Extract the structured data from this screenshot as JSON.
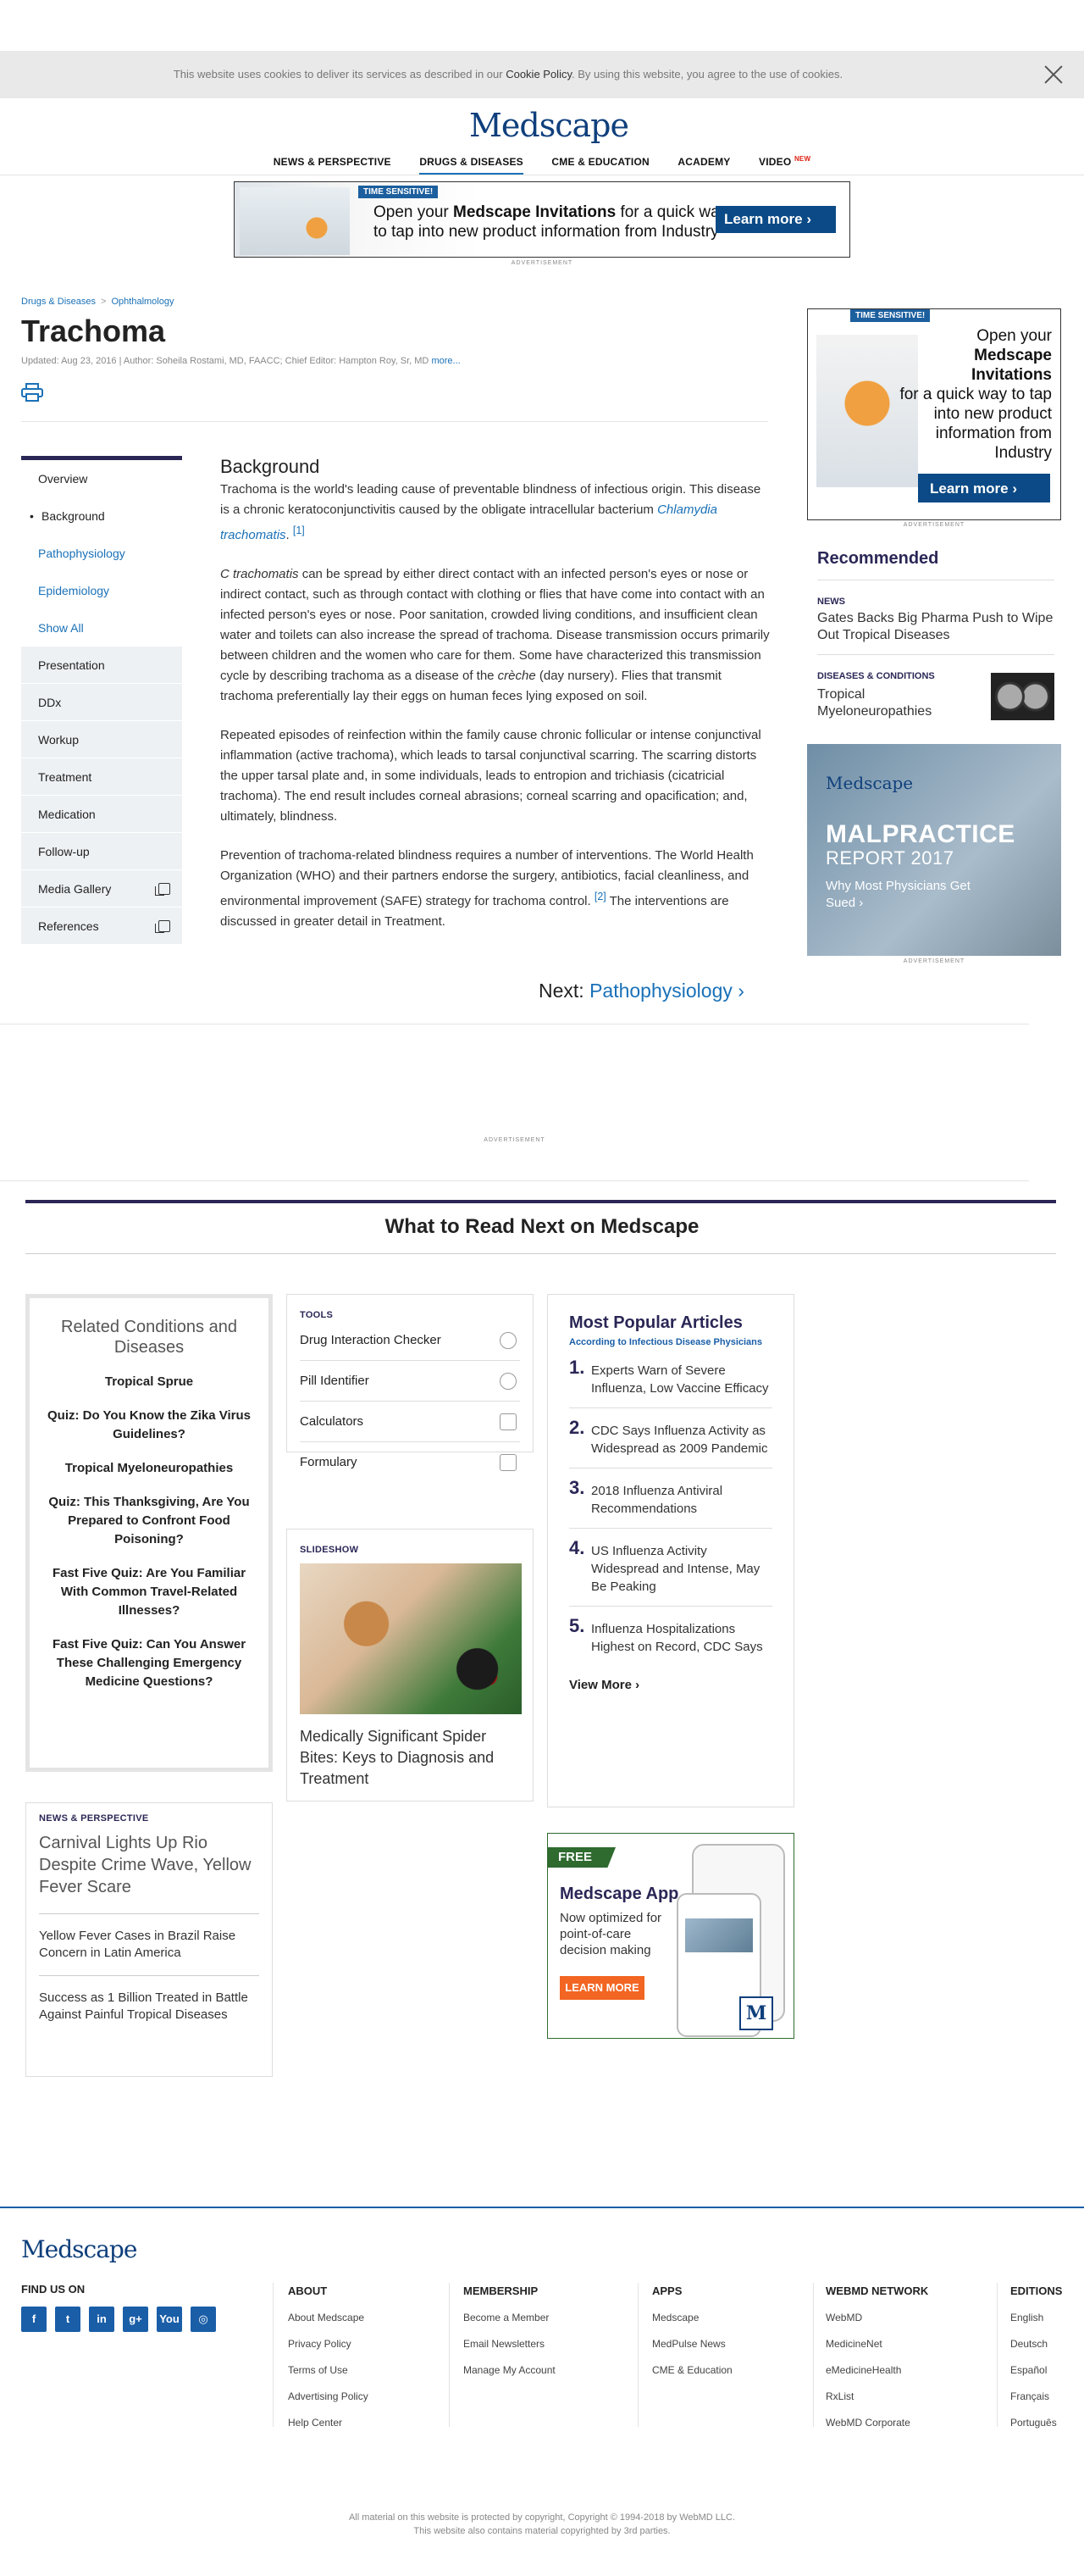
{
  "cookie": {
    "text_pre": "This website uses cookies to deliver its services as described in our ",
    "policy": "Cookie Policy",
    "text_post": ". By using this website, you agree to the use of cookies."
  },
  "header": {
    "logo": "Medscape",
    "nav": [
      "NEWS & PERSPECTIVE",
      "DRUGS & DISEASES",
      "CME & EDUCATION",
      "ACADEMY",
      "VIDEO"
    ],
    "nav_new": "NEW"
  },
  "banner_ad": {
    "badge": "TIME SENSITIVE!",
    "line1_pre": "Open your ",
    "line1_bold": "Medscape Invitations",
    "line1_post": " for a quick way",
    "line2": "to tap into new product information from Industry",
    "button": "Learn more",
    "label": "ADVERTISEMENT"
  },
  "breadcrumb": [
    "Drugs & Diseases",
    "Ophthalmology"
  ],
  "article": {
    "title": "Trachoma",
    "meta": "Updated: Aug 23, 2016  |  Author: Soheila Rostami, MD, FAACC; Chief Editor: Hampton Roy, Sr, MD",
    "meta_more": "more...",
    "section": "Background",
    "p1_pre": "Trachoma is the world's leading cause of preventable blindness of infectious origin. This disease is a chronic keratoconjunctivitis caused by the obligate intracellular bacterium ",
    "p1_link": "Chlamydia trachomatis",
    "p1_ref": "[1]",
    "p2_em": "C trachomatis",
    "p2_mid": " can be spread by either direct contact with an infected person's eyes or nose or indirect contact, such as through contact with clothing or flies that have come into contact with an infected person's eyes or nose. Poor sanitation, crowded living conditions, and insufficient clean water and toilets can also increase the spread of trachoma. Disease transmission occurs primarily between children and the women who care for them. Some have characterized this transmission cycle by describing trachoma as a disease of the ",
    "p2_em2": "crèche",
    "p2_end": " (day nursery). Flies that transmit trachoma preferentially lay their eggs on human feces lying exposed on soil.",
    "p3": "Repeated episodes of reinfection within the family cause chronic follicular or intense conjunctival inflammation (active trachoma), which leads to tarsal conjunctival scarring. The scarring distorts the upper tarsal plate and, in some individuals, leads to entropion and trichiasis (cicatricial trachoma). The end result includes corneal abrasions; corneal scarring and opacification; and, ultimately, blindness.",
    "p4_pre": "Prevention of trachoma-related blindness requires a number of interventions. The World Health Organization (WHO) and their partners endorse the surgery, antibiotics, facial cleanliness, and environmental improvement (SAFE) strategy for trachoma control.",
    "p4_ref": "[2]",
    "p4_post": " The interventions are discussed in greater detail in Treatment.",
    "next_label": "Next:",
    "next_link": "Pathophysiology"
  },
  "leftnav": {
    "overview": "Overview",
    "background": "Background",
    "pathophysiology": "Pathophysiology",
    "epidemiology": "Epidemiology",
    "show_all": "Show All",
    "presentation": "Presentation",
    "ddx": "DDx",
    "workup": "Workup",
    "treatment": "Treatment",
    "medication": "Medication",
    "followup": "Follow-up",
    "media": "Media Gallery",
    "references": "References"
  },
  "side_ad": {
    "badge": "TIME SENSITIVE!",
    "l1": "Open your",
    "l2": "Medscape Invitations",
    "l3": "for a quick way to tap into new product information from Industry",
    "button": "Learn more",
    "label": "ADVERTISEMENT"
  },
  "recommended": {
    "title": "Recommended",
    "items": [
      {
        "label": "NEWS",
        "title": "Gates Backs Big Pharma Push to Wipe Out Tropical Diseases"
      },
      {
        "label": "DISEASES & CONDITIONS",
        "title": "Tropical Myeloneuropathies"
      }
    ]
  },
  "malpractice_ad": {
    "logo": "Medscape",
    "headline": "MALPRACTICE",
    "sub": "REPORT 2017",
    "why": "Why Most Physicians Get Sued ›",
    "label": "ADVERTISEMENT"
  },
  "mid_ad_label": "ADVERTISEMENT",
  "read_next": {
    "title": "What to Read Next on Medscape",
    "related": {
      "heading": "Related Conditions and Diseases",
      "items": [
        "Tropical Sprue",
        "Quiz: Do You Know the Zika Virus Guidelines?",
        "Tropical Myeloneuropathies",
        "Quiz: This Thanksgiving, Are You Prepared to Confront Food Poisoning?",
        "Fast Five Quiz: Are You Familiar With Common Travel-Related Illnesses?",
        "Fast Five Quiz: Can You Answer These Challenging Emergency Medicine Questions?"
      ]
    },
    "tools": {
      "heading": "TOOLS",
      "items": [
        "Drug Interaction Checker",
        "Pill Identifier",
        "Calculators",
        "Formulary"
      ]
    },
    "slideshow": {
      "heading": "SLIDESHOW",
      "caption": "Medically Significant Spider Bites: Keys to Diagnosis and Treatment"
    },
    "popular": {
      "heading": "Most Popular Articles",
      "sub": "According to Infectious Disease Physicians",
      "items": [
        "Experts Warn of Severe Influenza, Low Vaccine Efficacy",
        "CDC Says Influenza Activity as Widespread as 2009 Pandemic",
        "2018 Influenza Antiviral Recommendations",
        "US Influenza Activity Widespread and Intense, May Be Peaking",
        "Influenza Hospitalizations Highest on Record, CDC Says"
      ],
      "view_more": "View More ›"
    },
    "news": {
      "heading": "NEWS & PERSPECTIVE",
      "items": [
        "Carnival Lights Up Rio Despite Crime Wave, Yellow Fever Scare",
        "Yellow Fever Cases in Brazil Raise Concern in Latin America",
        "Success as 1 Billion Treated in Battle Against Painful Tropical Diseases"
      ]
    },
    "app_ad": {
      "free": "FREE",
      "title": "Medscape App",
      "desc": "Now optimized for point-of-care decision making",
      "button": "LEARN MORE",
      "m": "M"
    }
  },
  "footer": {
    "logo": "Medscape",
    "find_us": "FIND US ON",
    "social": [
      "f",
      "t",
      "in",
      "g+",
      "You",
      "◎"
    ],
    "columns": [
      {
        "heading": "ABOUT",
        "links": [
          "About Medscape",
          "Privacy Policy",
          "Terms of Use",
          "Advertising Policy",
          "Help Center"
        ]
      },
      {
        "heading": "MEMBERSHIP",
        "links": [
          "Become a Member",
          "Email Newsletters",
          "Manage My Account"
        ]
      },
      {
        "heading": "APPS",
        "links": [
          "Medscape",
          "MedPulse News",
          "CME & Education"
        ]
      },
      {
        "heading": "WEBMD NETWORK",
        "links": [
          "WebMD",
          "MedicineNet",
          "eMedicineHealth",
          "RxList",
          "WebMD Corporate"
        ]
      },
      {
        "heading": "EDITIONS",
        "links": [
          "English",
          "Deutsch",
          "Español",
          "Français",
          "Português"
        ]
      }
    ],
    "copyright1": "All material on this website is protected by copyright, Copyright © 1994-2018 by WebMD LLC.",
    "copyright2": "This website also contains material copyrighted by 3rd parties."
  }
}
